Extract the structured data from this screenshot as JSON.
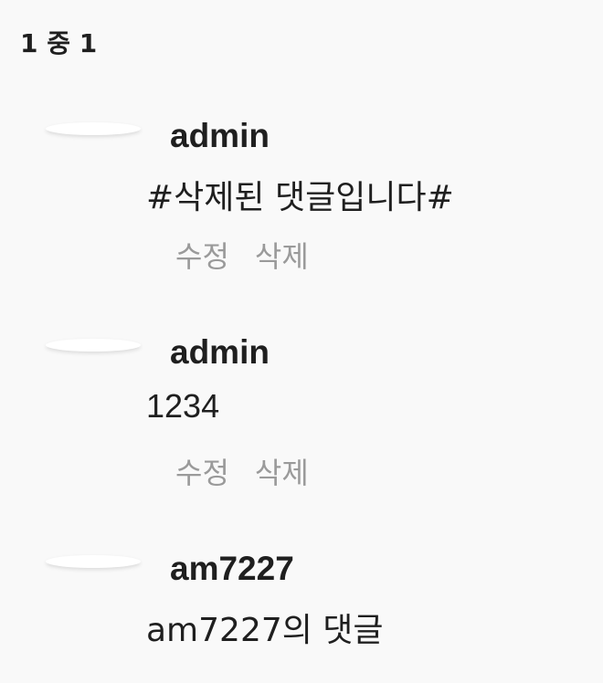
{
  "pagination": {
    "label": "1 중 1"
  },
  "comments": [
    {
      "author": "admin",
      "content": "#삭제된 댓글입니다#",
      "edit_label": "수정",
      "delete_label": "삭제"
    },
    {
      "author": "admin",
      "content": "1234",
      "edit_label": "수정",
      "delete_label": "삭제"
    },
    {
      "author": "am7227",
      "content": "am7227의 댓글"
    }
  ]
}
